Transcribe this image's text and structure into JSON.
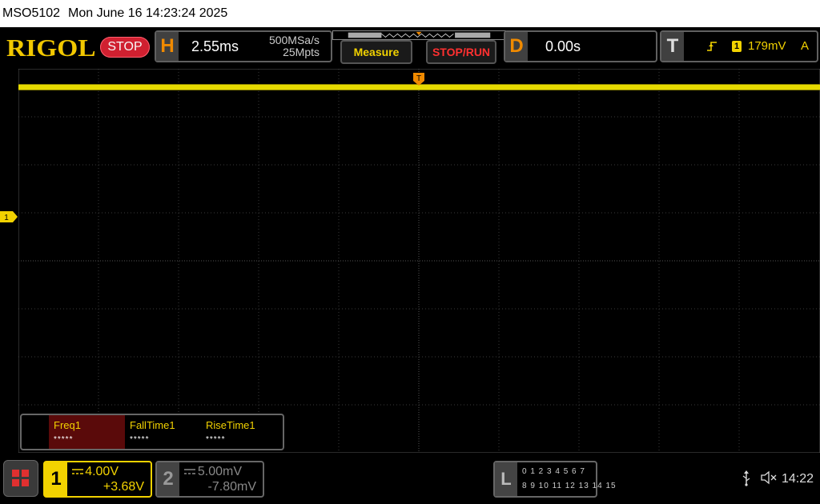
{
  "titlebar": {
    "model": "MSO5102",
    "datetime": "Mon June 16 14:23:24 2025"
  },
  "header": {
    "brand": "RIGOL",
    "run_state": "STOP",
    "horizontal": {
      "letter": "H",
      "timebase": "2.55ms",
      "sample_rate": "500MSa/s",
      "memory_depth": "25Mpts"
    },
    "measure_label": "Measure",
    "stoprun_label": "STOP/RUN",
    "delay": {
      "letter": "D",
      "value": "0.00s"
    },
    "trigger": {
      "letter": "T",
      "source": "1",
      "level": "179mV",
      "mode": "A"
    }
  },
  "waveform": {
    "ch1_marker_label": "1",
    "trigger_marker_label": "T",
    "trace_color": "#f2e600"
  },
  "measurements": [
    {
      "label": "Freq1",
      "value": "*****"
    },
    {
      "label": "FallTime1",
      "value": "*****"
    },
    {
      "label": "RiseTime1",
      "value": "*****"
    }
  ],
  "channels": {
    "ch1": {
      "number": "1",
      "scale": "4.00V",
      "offset": "+3.68V",
      "color": "#f2d200"
    },
    "ch2": {
      "number": "2",
      "scale": "5.00mV",
      "offset": "-7.80mV",
      "color": "#00e5ff"
    }
  },
  "logic": {
    "letter": "L",
    "row1": "0 1 2 3  4 5 6 7",
    "row2": "8 9 10 11 12 13 14 15"
  },
  "status": {
    "usb_icon": "usb-icon",
    "sound_icon": "speaker-muted-icon",
    "time": "14:22"
  }
}
